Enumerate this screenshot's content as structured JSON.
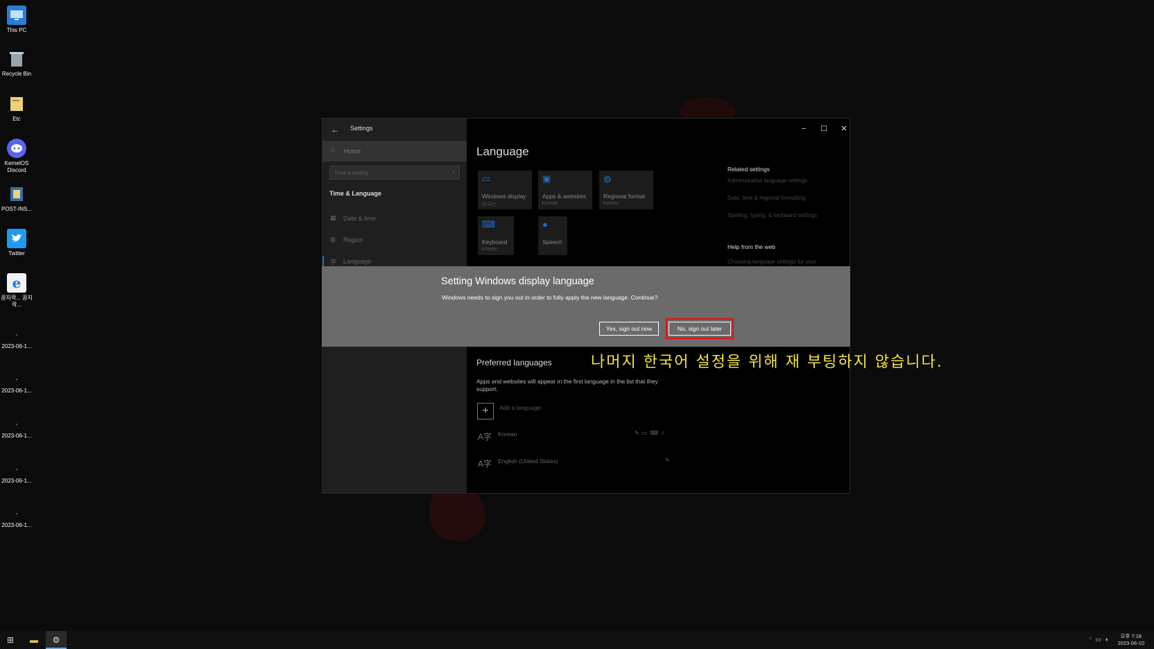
{
  "desktop": {
    "icons": [
      {
        "label": "This PC"
      },
      {
        "label": "Recycle Bin"
      },
      {
        "label": "Etc"
      },
      {
        "label": "KernelOS Discord"
      },
      {
        "label": "POST-INS..."
      },
      {
        "label": "Twitter"
      },
      {
        "label": "꿈지락... 꿈지락..."
      },
      {
        "label": "2023-06-1..."
      },
      {
        "label": "2023-06-1..."
      },
      {
        "label": "2023-06-1..."
      },
      {
        "label": "2023-06-1..."
      },
      {
        "label": "2023-06-1..."
      }
    ]
  },
  "window": {
    "title": "Settings",
    "controls": {
      "minimize": "−",
      "maximize": "☐",
      "close": "✕"
    }
  },
  "sidebar": {
    "home": "Home",
    "search_placeholder": "Find a setting",
    "section": "Time & Language",
    "items": [
      {
        "label": "Date & time"
      },
      {
        "label": "Region"
      },
      {
        "label": "Language"
      }
    ]
  },
  "main": {
    "title": "Language",
    "tiles": [
      {
        "label": "Windows display",
        "sub": "한국어"
      },
      {
        "label": "Apps & websites",
        "sub": "Korean"
      },
      {
        "label": "Regional format",
        "sub": "Korean"
      },
      {
        "label": "Keyboard",
        "sub": "Korean"
      },
      {
        "label": "Speech",
        "sub": ""
      }
    ],
    "related": {
      "heading": "Related settings",
      "links": [
        "Administrative language settings",
        "Date, time & regional formatting",
        "Spelling, typing, & keyboard settings"
      ]
    },
    "help": {
      "heading": "Help from the web",
      "link": "Choosing language settings for your"
    },
    "preferred": {
      "heading": "Preferred languages",
      "description": "Apps and websites will appear in the first language in the list that they support.",
      "add": "Add a language",
      "languages": [
        {
          "name": "Korean"
        },
        {
          "name": "English (United States)"
        }
      ]
    }
  },
  "dialog": {
    "title": "Setting Windows display language",
    "message": "Windows needs to sign you out in order to fully apply the new language. Continue?",
    "yes_label": "Yes, sign out now",
    "no_label": "No, sign out later"
  },
  "annotation": "나머지 한국어 설정을 위해 재 부팅하지 않습니다.",
  "taskbar": {
    "clock_time": "오후 7:18",
    "clock_date": "2023-06-10"
  },
  "colors": {
    "accent": "#1f6fc4",
    "highlight": "#e01010",
    "annotation": "#f5e642"
  }
}
